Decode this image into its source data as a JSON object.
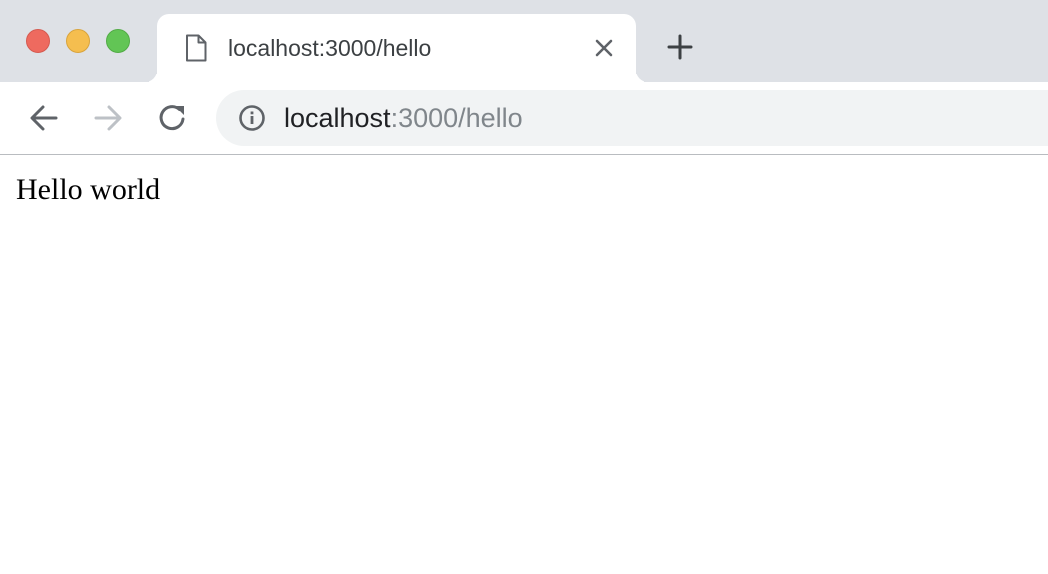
{
  "window": {
    "controls": [
      "close",
      "minimize",
      "maximize"
    ],
    "colors": {
      "close": "#ee6a5f",
      "minimize": "#f5be4f",
      "maximize": "#62c555",
      "tabstrip": "#dee1e6"
    }
  },
  "tab": {
    "title": "localhost:3000/hello",
    "favicon": "document-icon",
    "close_icon": "close-icon",
    "new_tab_icon": "plus-icon"
  },
  "toolbar": {
    "back_icon": "back-arrow-icon",
    "forward_icon": "forward-arrow-icon",
    "forward_enabled": false,
    "reload_icon": "reload-icon"
  },
  "omnibox": {
    "security_icon": "info-icon",
    "url_host": "localhost",
    "url_rest": ":3000/hello"
  },
  "page": {
    "body_text": "Hello world"
  }
}
